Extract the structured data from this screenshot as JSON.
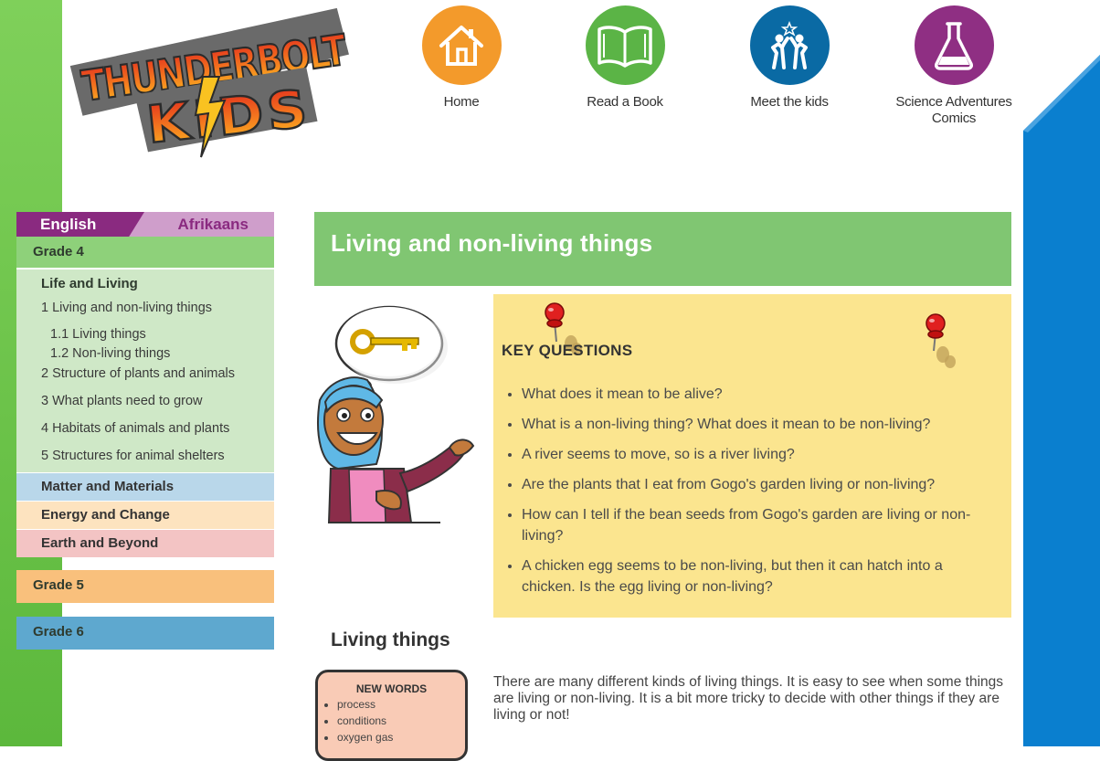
{
  "logo": {
    "line1": "THUNDERBOLT",
    "line2": "KIDS"
  },
  "nav": [
    {
      "label": "Home",
      "icon": "home-icon",
      "color": "#f39a2b"
    },
    {
      "label": "Read a Book",
      "icon": "book-icon",
      "color": "#5bb446"
    },
    {
      "label": "Meet the kids",
      "icon": "kids-icon",
      "color": "#0a6aa4"
    },
    {
      "label": "Science Adventures Comics",
      "icon": "flask-icon",
      "color": "#8f2f83"
    }
  ],
  "sidebar": {
    "lang_english": "English",
    "lang_afrikaans": "Afrikaans",
    "grade4": "Grade 4",
    "life_living": "Life and Living",
    "toc": [
      "1 Living and non-living things",
      "1.1 Living things",
      "1.2 Non-living things",
      "2 Structure of plants and animals",
      "3 What plants need to grow",
      "4 Habitats of animals and plants",
      "5 Structures for animal shelters"
    ],
    "topics": [
      "Matter and Materials",
      "Energy and Change",
      "Earth and Beyond"
    ],
    "grade5": "Grade 5",
    "grade6": "Grade 6"
  },
  "main": {
    "title": "Living and non-living things",
    "key_questions_title": "KEY QUESTIONS",
    "questions": [
      "What does it mean to be alive?",
      "What is a non-living thing? What does it mean to be non-living?",
      "A river seems to move, so is a river living?",
      "Are the plants that I eat from Gogo's garden living or non-living?",
      "How can I tell if the bean seeds from Gogo's garden are living or non-living?",
      "A chicken egg seems to be non-living, but then it can hatch into a chicken. Is the egg living or non-living?"
    ],
    "section_title": "Living things",
    "new_words_title": "NEW WORDS",
    "new_words": [
      "process",
      "conditions",
      "oxygen gas"
    ],
    "intro": "There are many different kinds of living things. It is easy to see when some things are living or non-living. It is a bit more tricky to decide with other things if they are living or not!"
  },
  "colors": {
    "green_band": "#6cc34b",
    "blue_band": "#0a7fcf",
    "title_bg": "#80c672",
    "questions_bg": "#fbe58f"
  }
}
